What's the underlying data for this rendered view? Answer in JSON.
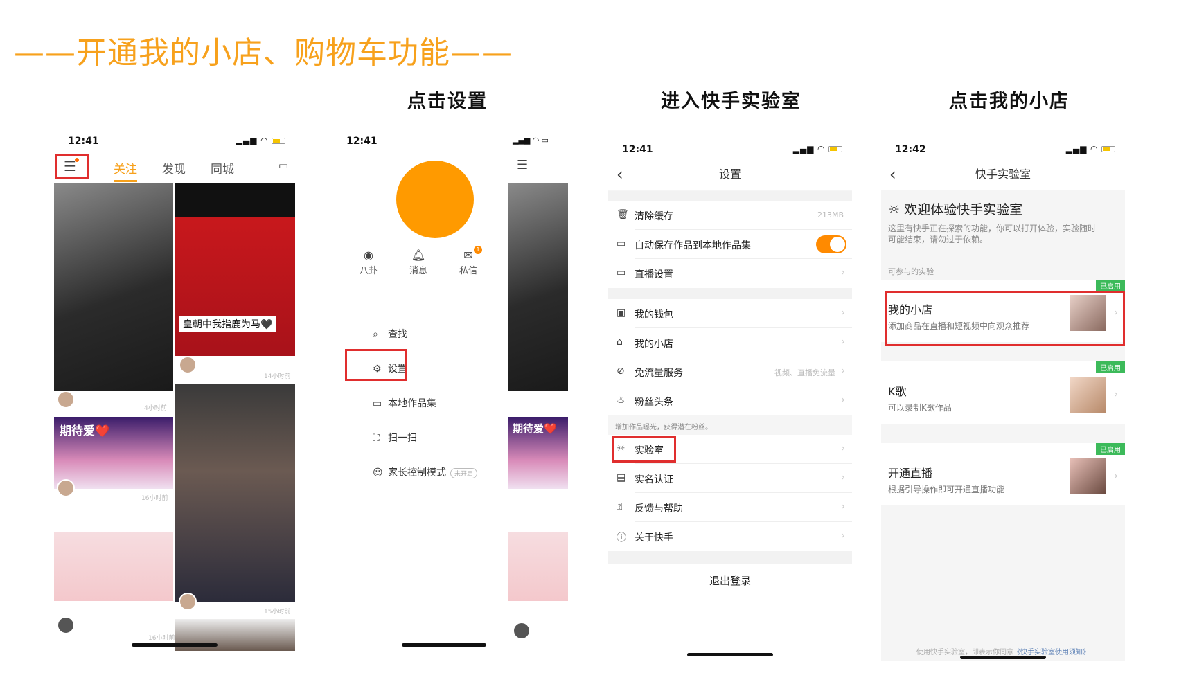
{
  "headline": "——开通我的小店、购物车功能——",
  "captions": [
    "点击设置",
    "进入快手实验室",
    "点击我的小店"
  ],
  "colors": {
    "accent": "#f7a11c",
    "highlight": "#e02e2e",
    "toggle_on": "#ff8a00",
    "enabled_tag": "#3cba5a"
  },
  "phone1": {
    "time": "12:41",
    "menu_icon": "hamburger-menu-icon",
    "tabs": [
      "关注",
      "发现",
      "同城"
    ],
    "feed": {
      "subtitle": "皇朝中我指鹿为马🖤",
      "tag": "期待爱❤️",
      "timestamps": [
        "4小时前",
        "14小时前",
        "16小时前",
        "15小时前",
        "16小时前"
      ]
    }
  },
  "phone2": {
    "time": "12:41",
    "quick": [
      {
        "icon": "eye-icon",
        "label": "八卦"
      },
      {
        "icon": "bell-icon",
        "label": "消息"
      },
      {
        "icon": "mail-icon",
        "label": "私信",
        "badge": "1"
      }
    ],
    "menu": [
      {
        "icon": "search-icon",
        "label": "查找"
      },
      {
        "icon": "gear-icon",
        "label": "设置"
      },
      {
        "icon": "folder-icon",
        "label": "本地作品集"
      },
      {
        "icon": "scan-icon",
        "label": "扫一扫"
      },
      {
        "icon": "parental-icon",
        "label": "家长控制模式",
        "pill": "未开启"
      }
    ],
    "feed_tag": "期待爱❤️"
  },
  "phone3": {
    "time": "12:41",
    "title": "设置",
    "rows": [
      {
        "icon": "trash-icon",
        "label": "清除缓存",
        "value": "213MB"
      },
      {
        "icon": "folder-icon",
        "label": "自动保存作品到本地作品集",
        "toggle": "on"
      },
      {
        "icon": "live-icon",
        "label": "直播设置"
      },
      {
        "icon": "wallet-icon",
        "label": "我的钱包"
      },
      {
        "icon": "shop-icon",
        "label": "我的小店"
      },
      {
        "icon": "data-icon",
        "label": "免流量服务",
        "value": "视频、直播免流量"
      },
      {
        "icon": "fire-icon",
        "label": "粉丝头条"
      },
      {
        "icon": "bulb-icon",
        "label": "实验室"
      },
      {
        "icon": "id-card-icon",
        "label": "实名认证"
      },
      {
        "icon": "help-icon",
        "label": "反馈与帮助"
      },
      {
        "icon": "info-icon",
        "label": "关于快手"
      }
    ],
    "fans_hint": "增加作品曝光，获得潜在粉丝。",
    "logout": "退出登录"
  },
  "phone4": {
    "time": "12:42",
    "title": "快手实验室",
    "welcome": "欢迎体验快手实验室",
    "desc": "这里有快手正在探索的功能，你可以打开体验，实验随时可能结束，请勿过于依赖。",
    "section": "可参与的实验",
    "experiments": [
      {
        "name": "我的小店",
        "desc": "添加商品在直播和短视频中向观众推荐",
        "tag": "已启用"
      },
      {
        "name": "K歌",
        "desc": "可以录制K歌作品",
        "tag": "已启用"
      },
      {
        "name": "开通直播",
        "desc": "根据引导操作即可开通直播功能",
        "tag": "已启用"
      }
    ],
    "footer_prefix": "使用快手实验室，即表示你同意",
    "footer_link": "《快手实验室使用须知》"
  }
}
